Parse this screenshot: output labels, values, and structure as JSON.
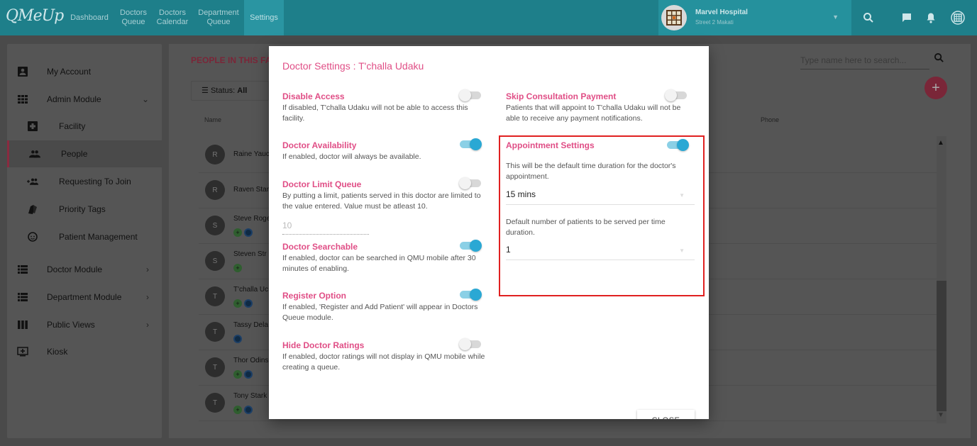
{
  "app": {
    "logo": "QMeUp",
    "nav": [
      "Dashboard",
      "Doctors Queue",
      "Doctors Calendar",
      "Department Queue",
      "Settings"
    ],
    "hospital": {
      "name": "Marvel Hospital",
      "street": "Street 2 Makati"
    }
  },
  "sidebar": {
    "items": [
      {
        "label": "My Account",
        "icon": "account-box-icon"
      },
      {
        "label": "Admin Module",
        "icon": "grid-icon"
      },
      {
        "label": "Facility",
        "icon": "hospital-plus-icon"
      },
      {
        "label": "People",
        "icon": "people-icon"
      },
      {
        "label": "Requesting To Join",
        "icon": "group-add-icon"
      },
      {
        "label": "Priority Tags",
        "icon": "tags-icon"
      },
      {
        "label": "Patient Management",
        "icon": "face-icon"
      },
      {
        "label": "Doctor Module",
        "icon": "list-icon"
      },
      {
        "label": "Department Module",
        "icon": "list-icon"
      },
      {
        "label": "Public Views",
        "icon": "columns-icon"
      },
      {
        "label": "Kiosk",
        "icon": "add-to-queue-icon"
      }
    ]
  },
  "people": {
    "title": "PEOPLE IN THIS FA",
    "filter_label": "Status:",
    "filter_value": "All",
    "search_placeholder": "Type name here to search...",
    "columns": {
      "name": "Name",
      "phone": "Phone"
    },
    "rows": [
      {
        "initial": "R",
        "name": "Raine Yauc"
      },
      {
        "initial": "R",
        "name": "Raven Star"
      },
      {
        "initial": "S",
        "name": "Steve Roge"
      },
      {
        "initial": "S",
        "name": "Steven Str"
      },
      {
        "initial": "T",
        "name": "T'challa Uc"
      },
      {
        "initial": "T",
        "name": "Tassy Dela"
      },
      {
        "initial": "T",
        "name": "Thor Odins"
      },
      {
        "initial": "T",
        "name": "Tony Stark"
      }
    ]
  },
  "modal": {
    "title": "Doctor Settings : T'challa Udaku",
    "left": [
      {
        "title": "Disable Access",
        "desc": "If disabled, T'challa Udaku will not be able to access this facility.",
        "enabled": false
      },
      {
        "title": "Doctor Availability",
        "desc": "If enabled, doctor will always be available.",
        "enabled": true
      },
      {
        "title": "Doctor Limit Queue",
        "desc": "By putting a limit, patients served in this doctor are limited to the value entered. Value must be atleast 10.",
        "enabled": false
      },
      {
        "title": "Doctor Searchable",
        "desc": "If enabled, doctor can be searched in QMU mobile after 30 minutes of enabling.",
        "enabled": true
      },
      {
        "title": "Register Option",
        "desc": "If enabled, 'Register and Add Patient' will appear in Doctors Queue module.",
        "enabled": true
      },
      {
        "title": "Hide Doctor Ratings",
        "desc": "If enabled, doctor ratings will not display in QMU mobile while creating a queue.",
        "enabled": false
      }
    ],
    "limit_placeholder": "10",
    "right": {
      "skip_title": "Skip Consultation Payment",
      "skip_desc": "Patients that will appoint to T'challa Udaku will not be able to receive any payment notifications.",
      "skip_enabled": false,
      "appt_title": "Appointment Settings",
      "appt_enabled": true,
      "duration_desc": "This will be the default time duration for the doctor's appointment.",
      "duration_value": "15 mins",
      "patients_desc": "Default number of patients to be served per time duration.",
      "patients_value": "1"
    },
    "close_label": "CLOSE"
  },
  "colors": {
    "accent": "#e04e86",
    "toggle_on": "#2aa8d4",
    "topbar": "#1e7f8a",
    "highlight_box": "#e02020"
  }
}
